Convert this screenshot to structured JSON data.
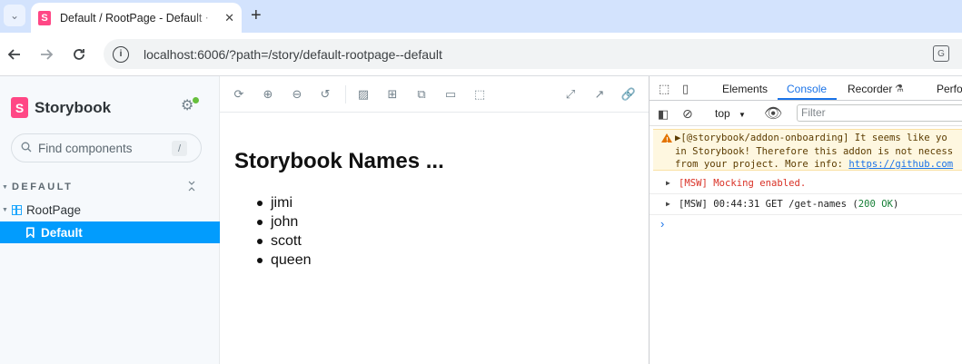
{
  "browser": {
    "tab_title": "Default / RootPage - Default ⋅",
    "favicon_letter": "S",
    "close_glyph": "✕",
    "new_tab_glyph": "+",
    "menu_glyph": "⌄",
    "url": "localhost:6006/?path=/story/default-rootpage--default",
    "icons": [
      "back-arrow-icon",
      "forward-arrow-icon",
      "reload-icon",
      "site-info-icon",
      "translate-icon"
    ]
  },
  "sidebar": {
    "brand": "Storybook",
    "brand_logo_letter": "S",
    "search_placeholder": "Find components",
    "search_shortcut": "/",
    "group_label": "DEFAULT",
    "component_label": "RootPage",
    "story_label": "Default",
    "status_color": "#66bf3c",
    "accent_color": "#029cfd"
  },
  "preview": {
    "toolbar_icons": [
      "remount-icon",
      "zoom-in-icon",
      "zoom-out-icon",
      "zoom-reset-icon",
      "background-icon",
      "grid-icon",
      "viewport-icon",
      "measure-icon",
      "outline-icon",
      "fullscreen-icon",
      "open-new-tab-icon",
      "copy-link-icon"
    ],
    "title": "Storybook Names ...",
    "names": [
      "jimi",
      "john",
      "scott",
      "queen"
    ]
  },
  "devtools": {
    "tabs": [
      "Elements",
      "Console",
      "Recorder",
      "Perfo"
    ],
    "active_tab": "Console",
    "context": "top",
    "filter_placeholder": "Filter",
    "messages": {
      "warn_line1": "▶[@storybook/addon-onboarding] It seems like yo",
      "warn_line2": "in Storybook! Therefore this addon is not necess",
      "warn_line3_prefix": "from your project. More info: ",
      "warn_line3_link": "https://github.com",
      "msw_enabled": "[MSW] Mocking enabled.",
      "msw_request_prefix": "[MSW] 00:44:31 GET /get-names (",
      "msw_request_status": "200 OK",
      "msw_request_suffix": ")"
    },
    "prompt_glyph": "›"
  }
}
